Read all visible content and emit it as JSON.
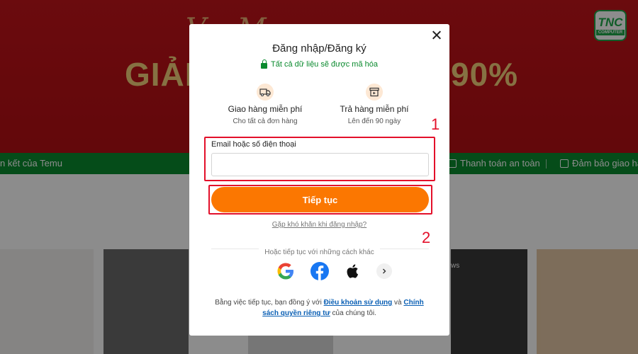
{
  "background": {
    "banner_script_text": "V... M...",
    "banner_left_text": "GIẢI",
    "banner_right_text": "90%",
    "logo": {
      "main": "TNC",
      "sub": "COMPUTER"
    },
    "green_bar": {
      "left_text": "n kết của Temu",
      "mid_text": "Thanh toán an toàn",
      "right_text": "Đảm bảo giao hà"
    },
    "tile_caption": "ws"
  },
  "modal": {
    "title": "Đăng nhập/Đăng ký",
    "secure_note": "Tất cả dữ liệu sẽ được mã hóa",
    "features": [
      {
        "icon": "truck-icon",
        "title": "Giao hàng miễn phí",
        "subtitle": "Cho tất cả đơn hàng"
      },
      {
        "icon": "return-box-icon",
        "title": "Trả hàng miễn phí",
        "subtitle": "Lên đến 90 ngày"
      }
    ],
    "email_label": "Email hoặc số điện thoại",
    "email_value": "",
    "continue_label": "Tiếp tục",
    "help_link": "Gặp khó khăn khi đăng nhập?",
    "divider_text": "Hoặc tiếp tục với những cách khác",
    "social": [
      "google-icon",
      "facebook-icon",
      "apple-icon",
      "chevron-right-icon"
    ],
    "terms": {
      "prefix": "Bằng việc tiếp tục, bạn đồng ý với ",
      "link1": "Điều khoản sử dụng",
      "middle": " và ",
      "link2": "Chính sách quyền riêng tư",
      "suffix": " của chúng tôi."
    }
  },
  "annotations": {
    "label_1": "1",
    "label_2": "2",
    "color": "#e3102a"
  },
  "colors": {
    "accent": "#fb7701",
    "secure_green": "#0a8a2e",
    "link_blue": "#0a5fb4"
  }
}
